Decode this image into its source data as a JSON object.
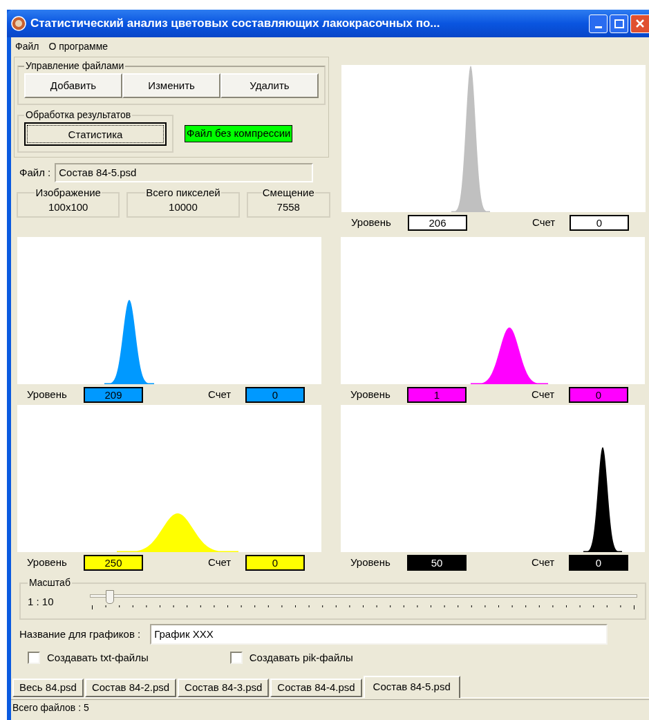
{
  "window": {
    "title": "Статистический анализ цветовых составляющих лакокрасочных по..."
  },
  "menu": [
    "Файл",
    "О программе"
  ],
  "file_management": {
    "title": "Управление файлами",
    "buttons": [
      "Добавить",
      "Изменить",
      "Удалить"
    ]
  },
  "processing": {
    "title": "Обработка результатов",
    "button": "Статистика",
    "badge": "Файл без компрессии"
  },
  "file_field": {
    "label": "Файл :",
    "value": "Состав 84-5.psd"
  },
  "info": [
    {
      "title": "Изображение",
      "value": "100x100"
    },
    {
      "title": "Всего пикселей",
      "value": "10000"
    },
    {
      "title": "Смещение",
      "value": "7558"
    }
  ],
  "histograms": [
    {
      "kind": "composite",
      "color": "#c0c0c0",
      "level_label": "Уровень",
      "level": "206",
      "count_label": "Счет",
      "count": "0"
    },
    {
      "kind": "channel",
      "color": "#0099ff",
      "level_label": "Уровень",
      "level": "209",
      "count_label": "Счет",
      "count": "0"
    },
    {
      "kind": "channel",
      "color": "#ff00ff",
      "level_label": "Уровень",
      "level": "1",
      "count_label": "Счет",
      "count": "0"
    },
    {
      "kind": "channel",
      "color": "#ffff00",
      "level_label": "Уровень",
      "level": "250",
      "count_label": "Счет",
      "count": "0"
    },
    {
      "kind": "channel",
      "color": "#000000",
      "level_label": "Уровень",
      "level": "50",
      "count_label": "Счет",
      "count": "0"
    }
  ],
  "scale": {
    "title": "Масштаб",
    "reading": "1 : 10",
    "slider": {
      "level": 0.03
    }
  },
  "chart_name": {
    "label": "Название для графиков :",
    "value": "График XXX"
  },
  "checkboxes": [
    {
      "label": "Создавать txt-файлы",
      "checked": false
    },
    {
      "label": "Создавать pik-файлы",
      "checked": false
    }
  ],
  "tabs": [
    {
      "label": "Весь 84.psd",
      "selected": false
    },
    {
      "label": "Состав 84-2.psd",
      "selected": false
    },
    {
      "label": "Состав 84-3.psd",
      "selected": false
    },
    {
      "label": "Состав 84-4.psd",
      "selected": false
    },
    {
      "label": "Состав 84-5.psd",
      "selected": true
    }
  ],
  "status_bar": "Всего файлов : 5"
}
